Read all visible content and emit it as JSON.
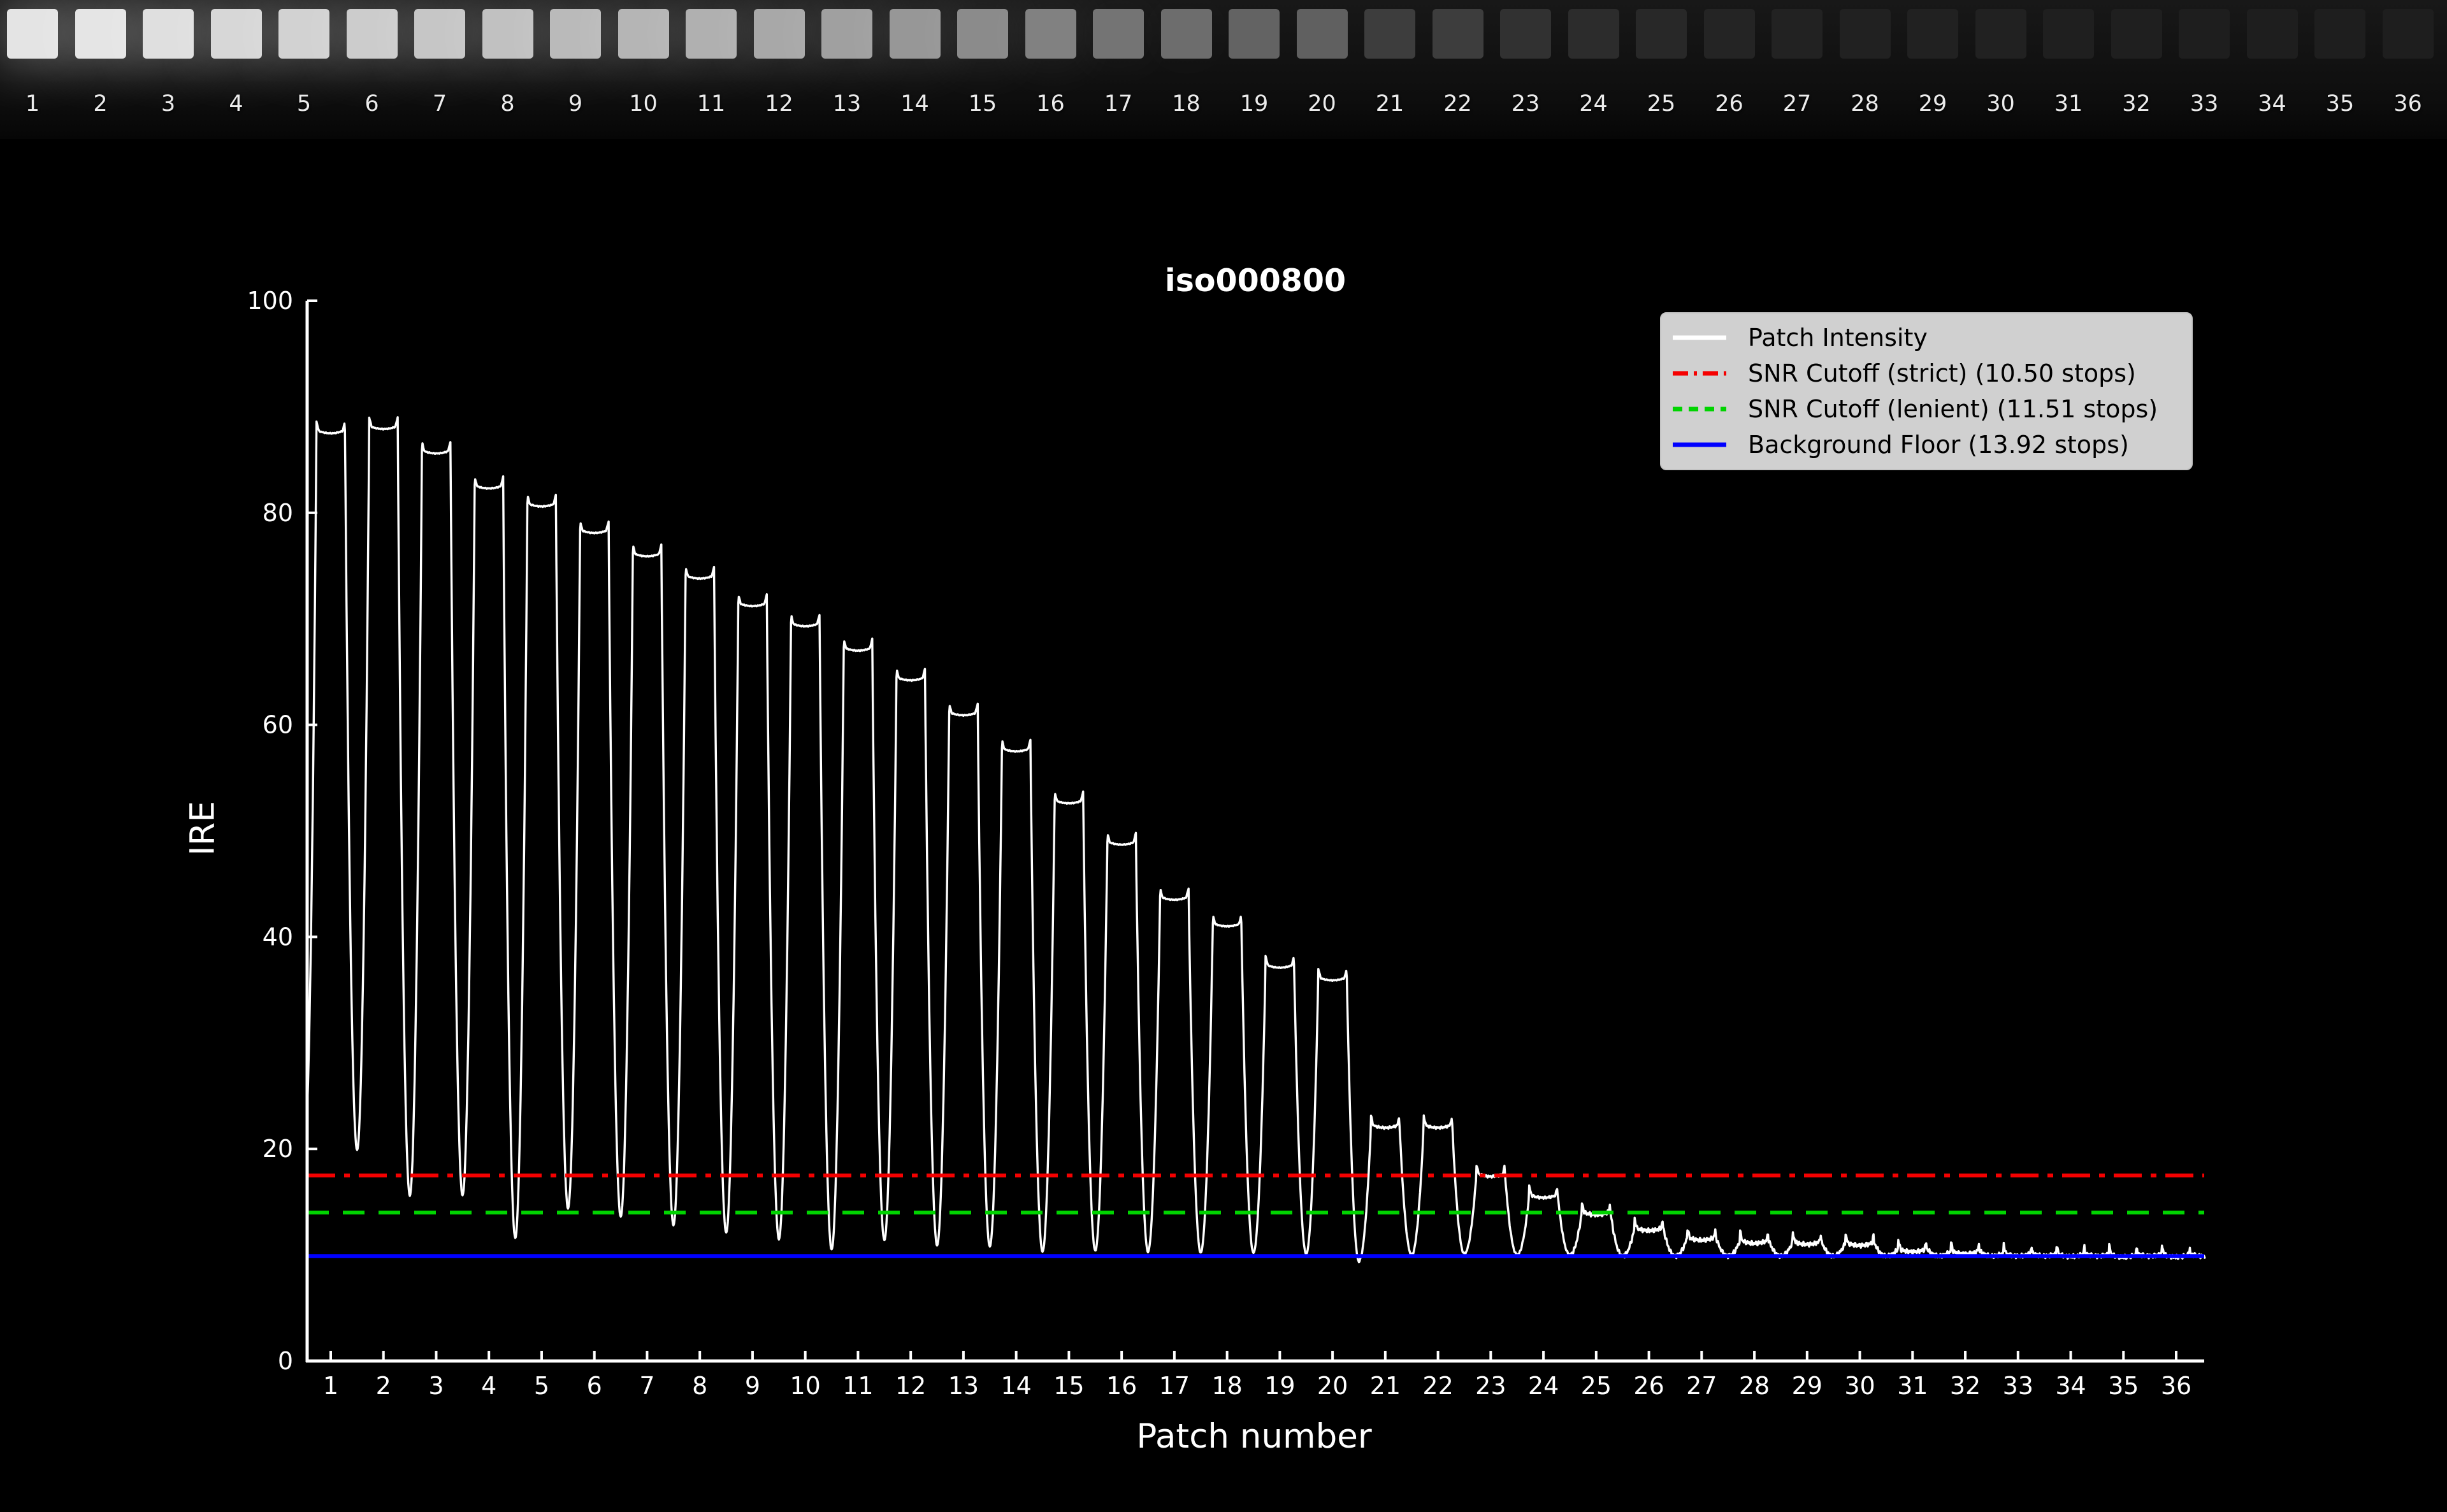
{
  "strip": {
    "patch_labels": [
      "1",
      "2",
      "3",
      "4",
      "5",
      "6",
      "7",
      "8",
      "9",
      "10",
      "11",
      "12",
      "13",
      "14",
      "15",
      "16",
      "17",
      "18",
      "19",
      "20",
      "21",
      "22",
      "23",
      "24",
      "25",
      "26",
      "27",
      "28",
      "29",
      "30",
      "31",
      "32",
      "33",
      "34",
      "35",
      "36"
    ]
  },
  "chart": {
    "title": "iso000800",
    "xlabel": "Patch number",
    "ylabel": "IRE",
    "colors": {
      "background": "#000000",
      "foreground": "#ffffff",
      "trace": "#ffffff",
      "snr_strict": "#f50000",
      "snr_lenient": "#00d400",
      "background_floor": "#0000ff",
      "legend_bg": "#d0d0d0",
      "legend_text": "#000000"
    },
    "legend": {
      "items": [
        {
          "label": "Patch Intensity",
          "color": "#ffffff",
          "dash": "solid"
        },
        {
          "label": "SNR Cutoff (strict) (10.50 stops)",
          "color": "#f50000",
          "dash": "dashdot"
        },
        {
          "label": "SNR Cutoff (lenient) (11.51 stops)",
          "color": "#00d400",
          "dash": "dashed"
        },
        {
          "label": "Background Floor (13.92 stops)",
          "color": "#0000ff",
          "dash": "solid"
        }
      ]
    }
  },
  "chart_data": {
    "type": "line",
    "title": "iso000800",
    "xlabel": "Patch number",
    "ylabel": "IRE",
    "xlim": [
      0.55,
      36.55
    ],
    "ylim": [
      0,
      100
    ],
    "grid": false,
    "legend_position": "upper-right",
    "x_tick_labels": [
      "1",
      "2",
      "3",
      "4",
      "5",
      "6",
      "7",
      "8",
      "9",
      "10",
      "11",
      "12",
      "13",
      "14",
      "15",
      "16",
      "17",
      "18",
      "19",
      "20",
      "21",
      "22",
      "23",
      "24",
      "25",
      "26",
      "27",
      "28",
      "29",
      "30",
      "31",
      "32",
      "33",
      "34",
      "35",
      "36"
    ],
    "y_tick_labels": [
      "0",
      "20",
      "40",
      "60",
      "80",
      "100"
    ],
    "y_ticks": [
      0,
      20,
      40,
      60,
      80,
      100
    ],
    "series": [
      {
        "name": "Patch Intensity",
        "shape": "square-wave",
        "patch_numbers": [
          1,
          2,
          3,
          4,
          5,
          6,
          7,
          8,
          9,
          10,
          11,
          12,
          13,
          14,
          15,
          16,
          17,
          18,
          19,
          20,
          21,
          22,
          23,
          24,
          25,
          26,
          27,
          28,
          29,
          30,
          31,
          32,
          33,
          34,
          35,
          36
        ],
        "patch_peak_ire": [
          87.8,
          88.2,
          85.9,
          82.6,
          80.9,
          78.4,
          76.2,
          74.1,
          71.5,
          69.6,
          67.3,
          64.5,
          61.2,
          57.8,
          52.9,
          49.0,
          43.8,
          41.3,
          37.4,
          36.2,
          22.3,
          22.3,
          17.7,
          15.7,
          14.1,
          12.6,
          11.7,
          11.4,
          11.3,
          11.2,
          10.6,
          10.4,
          10.2,
          10.15,
          10.1,
          10.1
        ],
        "inter_patch_valley_ire": [
          20.0,
          19.9,
          15.6,
          15.6,
          11.6,
          14.4,
          13.6,
          12.8,
          12.1,
          11.5,
          10.5,
          11.4,
          10.9,
          10.8,
          10.3,
          10.4,
          10.3,
          10.2,
          10.2,
          10.1,
          9.4,
          10.0,
          10.1,
          10.0,
          10.0,
          9.9,
          9.9,
          9.9,
          9.9,
          9.9,
          9.9,
          9.9,
          9.9,
          9.9,
          9.9,
          9.9,
          9.9
        ]
      }
    ],
    "hlines": [
      {
        "name": "SNR Cutoff (strict)",
        "stops": "10.50",
        "y": 17.5,
        "color": "#f50000",
        "dash": "dashdot"
      },
      {
        "name": "SNR Cutoff (lenient)",
        "stops": "11.51",
        "y": 14.0,
        "color": "#00d400",
        "dash": "dashed"
      },
      {
        "name": "Background Floor",
        "stops": "13.92",
        "y": 9.9,
        "color": "#0000ff",
        "dash": "solid"
      }
    ]
  }
}
